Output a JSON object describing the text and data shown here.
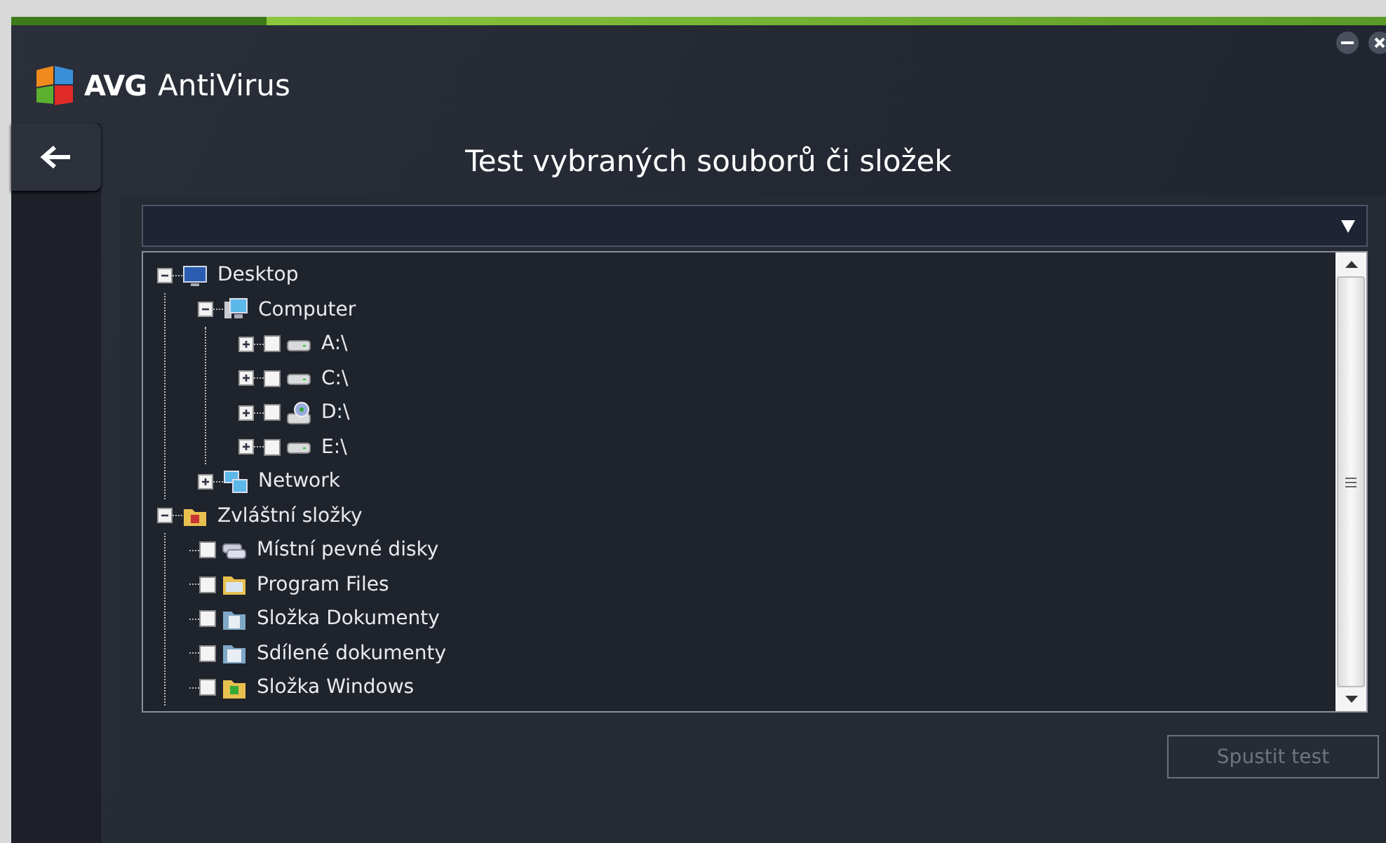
{
  "window": {
    "logo_text": "AVG",
    "app_name": "AntiVirus"
  },
  "page_title": "Test vybraných souborů či složek",
  "tree": [
    {
      "label": "Desktop",
      "kind": "monitor",
      "expanded": true,
      "children": [
        {
          "label": "Computer",
          "kind": "computer",
          "expanded": true,
          "children": [
            {
              "label": "A:\\",
              "kind": "drive",
              "expanded": false,
              "checked": false
            },
            {
              "label": "C:\\",
              "kind": "drive",
              "expanded": false,
              "checked": false
            },
            {
              "label": "D:\\",
              "kind": "cd-drive",
              "expanded": false,
              "checked": false
            },
            {
              "label": "E:\\",
              "kind": "drive",
              "expanded": false,
              "checked": false
            }
          ]
        },
        {
          "label": "Network",
          "kind": "network",
          "expanded": false
        }
      ]
    },
    {
      "label": "Zvláštní složky",
      "kind": "special-folder",
      "expanded": true,
      "children": [
        {
          "label": "Místní pevné disky",
          "kind": "disk-group",
          "checked": false
        },
        {
          "label": "Program Files",
          "kind": "folder",
          "checked": false
        },
        {
          "label": "Složka Dokumenty",
          "kind": "documents-folder",
          "checked": false
        },
        {
          "label": "Sdílené dokumenty",
          "kind": "shared-folder",
          "checked": false
        },
        {
          "label": "Složka Windows",
          "kind": "windows-folder",
          "checked": false
        }
      ]
    }
  ],
  "start_button": {
    "label": "Spustit test",
    "disabled": true
  }
}
